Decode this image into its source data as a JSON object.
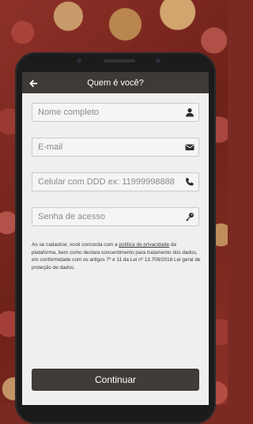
{
  "header": {
    "title": "Quem é você?"
  },
  "form": {
    "name_placeholder": "Nome completo",
    "email_placeholder": "E-mail",
    "phone_placeholder": "Celular com DDD ex: 11999998888",
    "password_placeholder": "Senha de acesso"
  },
  "consent": {
    "text_before": "Ao se cadastrar, você concorda com a ",
    "link": "política de privacidade",
    "text_after": " da plataforma, bem como declara consentimento para tratamento dos dados, em conformidade com os artigos 7º e 11 da Lei nº 13.709/2018 Lei geral de proteção de dados."
  },
  "actions": {
    "continue_label": "Continuar"
  },
  "icons": {
    "back": "arrow-left-icon",
    "name": "user-icon",
    "email": "envelope-icon",
    "phone": "phone-icon",
    "password": "key-icon"
  },
  "colors": {
    "appbar": "#3e3b36",
    "button": "#403c37",
    "screen_bg": "#efefef"
  }
}
